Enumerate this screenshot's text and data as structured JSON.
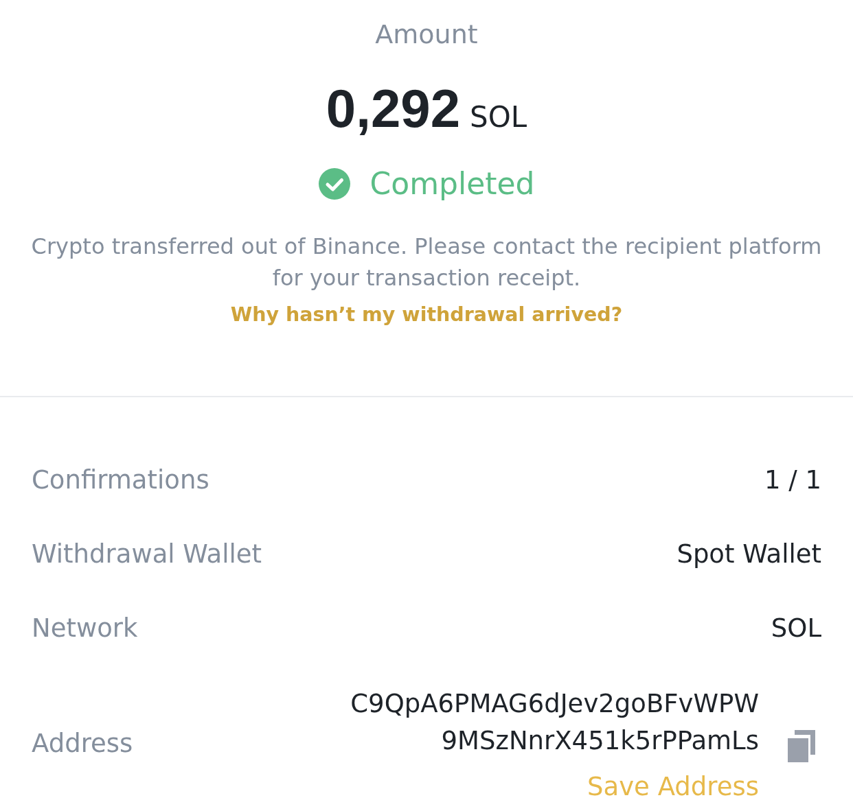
{
  "header": {
    "title": "Amount",
    "amount": "0,292",
    "unit": "SOL"
  },
  "status": {
    "kind": "completed",
    "label": "Completed"
  },
  "notice": "Crypto transferred out of Binance. Please contact the recipient platform for your transaction receipt.",
  "help_link": "Why hasn’t my withdrawal arrived?",
  "details": [
    {
      "kind": "text",
      "label": "Confirmations",
      "value": "1 / 1"
    },
    {
      "kind": "text",
      "label": "Withdrawal Wallet",
      "value": "Spot Wallet"
    },
    {
      "kind": "text",
      "label": "Network",
      "value": "SOL"
    },
    {
      "kind": "address",
      "label": "Address",
      "value_lines": [
        "C9QpA6PMAG6dJev2goBFvWPW",
        "9MSzNnrX451k5rPPamLs"
      ],
      "action": "Save Address"
    }
  ]
}
